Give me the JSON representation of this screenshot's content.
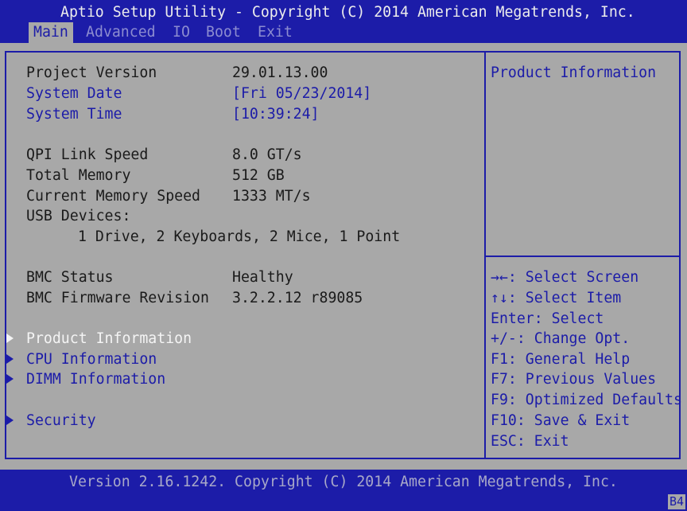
{
  "header": {
    "title": "Aptio Setup Utility - Copyright (C) 2014 American Megatrends, Inc.",
    "tabs": [
      "Main",
      "Advanced",
      "IO",
      "Boot",
      "Exit"
    ]
  },
  "main": {
    "project_version": {
      "label": "Project Version",
      "value": "29.01.13.00"
    },
    "system_date": {
      "label": "System Date",
      "value": "[Fri 05/23/2014]"
    },
    "system_time": {
      "label": "System Time",
      "value": "[10:39:24]"
    },
    "qpi_link_speed": {
      "label": "QPI Link Speed",
      "value": "8.0 GT/s"
    },
    "total_memory": {
      "label": "Total Memory",
      "value": "512 GB"
    },
    "current_memory_speed": {
      "label": "Current Memory Speed",
      "value": "1333 MT/s"
    },
    "usb_devices": {
      "label": "USB Devices:",
      "value": "1 Drive, 2 Keyboards, 2 Mice, 1 Point"
    },
    "bmc_status": {
      "label": "BMC Status",
      "value": "Healthy"
    },
    "bmc_firmware": {
      "label": "BMC Firmware Revision",
      "value": "3.2.2.12 r89085"
    },
    "submenus": [
      "Product Information",
      "CPU Information",
      "DIMM Information",
      "Security"
    ]
  },
  "help": {
    "text": "Product Information"
  },
  "keys": [
    {
      "key": "→←:",
      "action": " Select Screen"
    },
    {
      "key": "↑↓:",
      "action": " Select Item"
    },
    {
      "key": "Enter:",
      "action": " Select"
    },
    {
      "key": "+/-:",
      "action": " Change Opt."
    },
    {
      "key": "F1:",
      "action": " General Help"
    },
    {
      "key": "F7:",
      "action": " Previous Values"
    },
    {
      "key": "F9:",
      "action": " Optimized Defaults"
    },
    {
      "key": "F10:",
      "action": " Save & Exit"
    },
    {
      "key": "ESC:",
      "action": " Exit"
    }
  ],
  "footer": {
    "version": "Version 2.16.1242. Copyright (C) 2014 American Megatrends, Inc.",
    "code": "B4"
  },
  "colors": {
    "background": "#a8a8a8",
    "accent": "#1c1ca8",
    "highlight": "#f4f4f4"
  }
}
